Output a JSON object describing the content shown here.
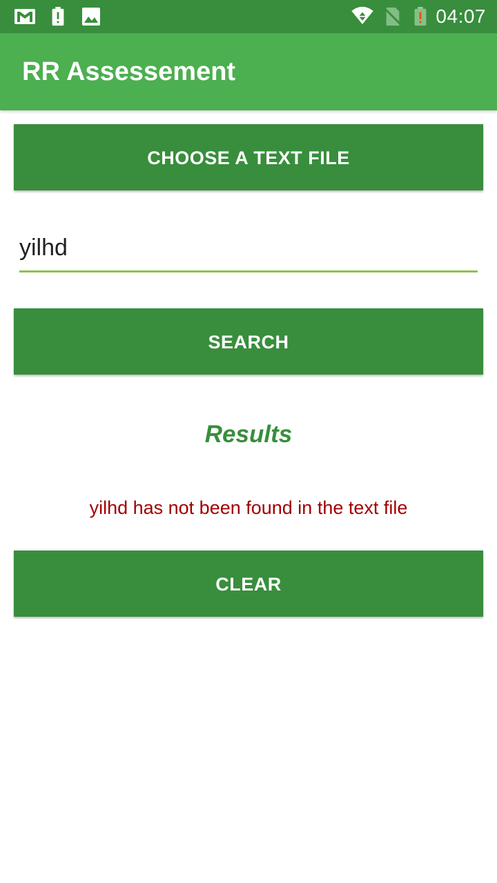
{
  "status_bar": {
    "time": "04:07",
    "icons": [
      "gmail-icon",
      "battery-alert-icon",
      "image-icon",
      "wifi-icon",
      "no-sim-icon",
      "battery-low-icon"
    ]
  },
  "app_bar": {
    "title": "RR Assessement"
  },
  "main": {
    "choose_file_label": "CHOOSE A TEXT FILE",
    "search_input_value": "yilhd",
    "search_label": "SEARCH",
    "results_heading": "Results",
    "result_message": "yilhd has not been found in the text file",
    "clear_label": "CLEAR"
  },
  "colors": {
    "status_bar": "#388e3c",
    "app_bar": "#4caf50",
    "button": "#388e3c",
    "input_underline": "#8bc34a",
    "results_heading": "#388e3c",
    "result_message": "#a00000"
  }
}
